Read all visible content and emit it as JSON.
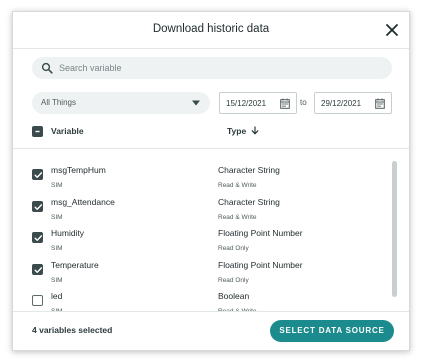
{
  "dialog": {
    "title": "Download historic data"
  },
  "search": {
    "placeholder": "Search variable",
    "value": ""
  },
  "filter": {
    "selected": "All Things"
  },
  "dates": {
    "from": "15/12/2021",
    "separator": "to",
    "to": "29/12/2021"
  },
  "table": {
    "header_checkbox": "indeterminate",
    "columns": {
      "variable": "Variable",
      "type": "Type"
    },
    "sort": {
      "column": "type",
      "direction": "desc"
    },
    "rows": [
      {
        "name": "msgTempHum",
        "source": "SIM",
        "type": "Character String",
        "access": "Read & Write",
        "checked": true
      },
      {
        "name": "msg_Attendance",
        "source": "SIM",
        "type": "Character String",
        "access": "Read & Write",
        "checked": true
      },
      {
        "name": "Humidity",
        "source": "SIM",
        "type": "Floating Point Number",
        "access": "Read Only",
        "checked": true
      },
      {
        "name": "Temperature",
        "source": "SIM",
        "type": "Floating Point Number",
        "access": "Read Only",
        "checked": true
      },
      {
        "name": "led",
        "source": "SIM",
        "type": "Boolean",
        "access": "Read & Write",
        "checked": false
      }
    ]
  },
  "footer": {
    "selection_count": "4 variables selected",
    "action": "SELECT DATA SOURCE"
  },
  "colors": {
    "accent": "#1c8b8d",
    "checkbox": "#3b4b4d",
    "field_bg": "#eef2f2"
  }
}
